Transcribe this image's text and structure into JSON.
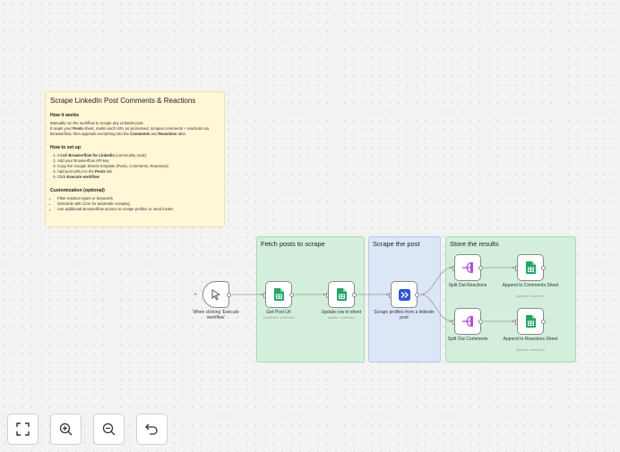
{
  "note": {
    "title": "Scrape LinkedIn Post Comments & Reactions",
    "how_heading": "How it works",
    "how_line1": "Manually run the workflow to scrape any LinkedIn post.",
    "how_line2_a": "It reads your ",
    "how_line2_b": "Posts",
    "how_line2_c": " sheet, marks each URL as processed, scrapes comments + reactions via Browserflow, then appends everything into the ",
    "how_line2_d": "Comments",
    "how_line2_e": " and ",
    "how_line2_f": "Reactions",
    "how_line2_g": " tabs.",
    "setup_heading": "How to set up",
    "setup_steps": [
      {
        "pre": "Install ",
        "bold": "Browserflow for Linkedin",
        "post": " (community node)"
      },
      {
        "pre": "Add your Browserflow API key",
        "bold": "",
        "post": ""
      },
      {
        "pre": "Copy the Google Sheets template (Posts, Comments, Reactions)",
        "bold": "",
        "post": ""
      },
      {
        "pre": "Add post URLs to the ",
        "bold": "Posts",
        "post": " tab"
      },
      {
        "pre": "Click ",
        "bold": "Execute workflow",
        "post": ""
      }
    ],
    "custom_heading": "Customization (optional)",
    "custom_items": [
      "Filter reaction types or keywords",
      "Schedule with Cron for automatic scraping",
      "Use additional Browserflow actions to scrape profiles or send invites"
    ]
  },
  "stickies": {
    "fetch": "Fetch posts to scrape",
    "scrape": "Scrape the post",
    "store": "Store the results"
  },
  "nodes": {
    "trigger": {
      "label": "When clicking 'Execute workflow'",
      "icon": "cursor-icon"
    },
    "get_post": {
      "label": "Get Post Url",
      "sub": "undefined: undefined",
      "icon": "google-sheets-icon"
    },
    "update_row": {
      "label": "Update row in sheet",
      "sub": "update: undefined",
      "icon": "google-sheets-icon"
    },
    "scrape": {
      "label": "Scrape profiles from a linkedin post",
      "icon": "browserflow-icon"
    },
    "split_reactions": {
      "label": "Split Out Reactions",
      "icon": "split-out-icon"
    },
    "split_comments": {
      "label": "Split Out Comments",
      "icon": "split-out-icon"
    },
    "append_comments": {
      "label": "Append to Comments Sheet",
      "sub": "append: undefined",
      "icon": "google-sheets-icon"
    },
    "append_reactions": {
      "label": "Append to Reactions Sheet",
      "sub": "append: undefined",
      "icon": "google-sheets-icon"
    }
  },
  "controls": [
    "fit-view-icon",
    "zoom-in-icon",
    "zoom-out-icon",
    "undo-icon"
  ],
  "colors": {
    "canvas": "#f3f3f3",
    "note": "#fff7d6",
    "green_section": "#d3efdc",
    "blue_section": "#dbe6f7",
    "sheets": "#23a566",
    "split": "#b04fd8",
    "browserflow": "#2f54d8"
  }
}
